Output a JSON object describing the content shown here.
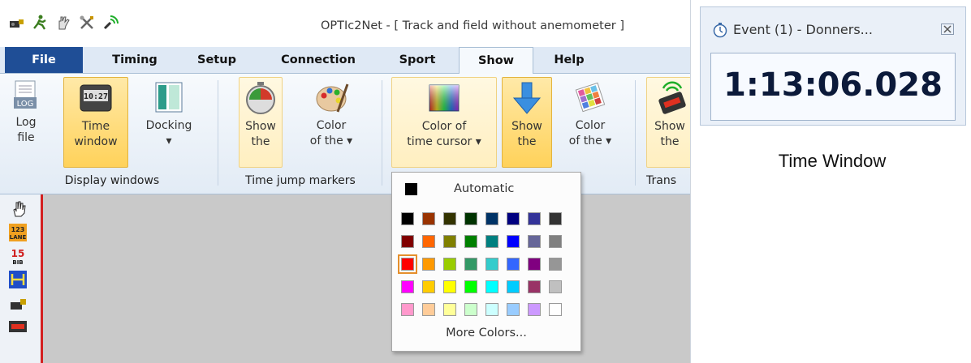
{
  "window": {
    "title": "OPTIc2Net - [ Track and field without anemometer ]"
  },
  "quick_access": [
    "camera-icon",
    "runner-icon",
    "glove-icon",
    "tools-icon",
    "antenna-icon"
  ],
  "tabs": [
    {
      "label": "File",
      "active": false
    },
    {
      "label": "Timing"
    },
    {
      "label": "Setup"
    },
    {
      "label": "Connection"
    },
    {
      "label": "Sport"
    },
    {
      "label": "Show",
      "active": true
    },
    {
      "label": "Help"
    }
  ],
  "ribbon": {
    "log_file": {
      "line1": "Log",
      "line2": "file"
    },
    "time_window": {
      "line1": "Time",
      "line2": "window"
    },
    "docking": {
      "line1": "Docking",
      "line2": "▾"
    },
    "show_markers": {
      "line1": "Show",
      "line2": "the"
    },
    "color_markers": {
      "line1": "Color",
      "line2": "of the ▾"
    },
    "color_cursor": {
      "line1": "Color of",
      "line2": "time cursor ▾"
    },
    "show_cursor": {
      "line1": "Show",
      "line2": "the"
    },
    "color_other": {
      "line1": "Color",
      "line2": "of the ▾"
    },
    "show_trans": {
      "line1": "Show",
      "line2": "the"
    },
    "groups": {
      "display": "Display windows",
      "markers": "Time jump markers",
      "trans": "Trans"
    }
  },
  "color_menu": {
    "automatic_label": "Automatic",
    "automatic_color": "#000000",
    "selected": "#ff0000",
    "rows": [
      [
        "#000000",
        "#993300",
        "#333300",
        "#003300",
        "#003366",
        "#000080",
        "#333399",
        "#333333"
      ],
      [
        "#800000",
        "#ff6600",
        "#808000",
        "#008000",
        "#008080",
        "#0000ff",
        "#666699",
        "#808080"
      ],
      [
        "#ff0000",
        "#ff9900",
        "#99cc00",
        "#339966",
        "#33cccc",
        "#3366ff",
        "#800080",
        "#969696"
      ],
      [
        "#ff00ff",
        "#ffcc00",
        "#ffff00",
        "#00ff00",
        "#00ffff",
        "#00ccff",
        "#993366",
        "#c0c0c0"
      ],
      [
        "#ff99cc",
        "#ffcc99",
        "#ffff99",
        "#ccffcc",
        "#ccffff",
        "#99ccff",
        "#cc99ff",
        "#ffffff"
      ]
    ],
    "more_label": "More Colors..."
  },
  "side_toolbar": [
    "hand-icon",
    "lane-icon",
    "bib-icon",
    "range-icon",
    "camera-icon",
    "display-icon"
  ],
  "time_window": {
    "title": "Event (1) - Donners...",
    "time": "1:13:06.028",
    "caption": "Time Window"
  },
  "colors": {
    "file_tab": "#1f4e96",
    "highlight": "#ffd25a",
    "marker_red": "#d32020"
  }
}
